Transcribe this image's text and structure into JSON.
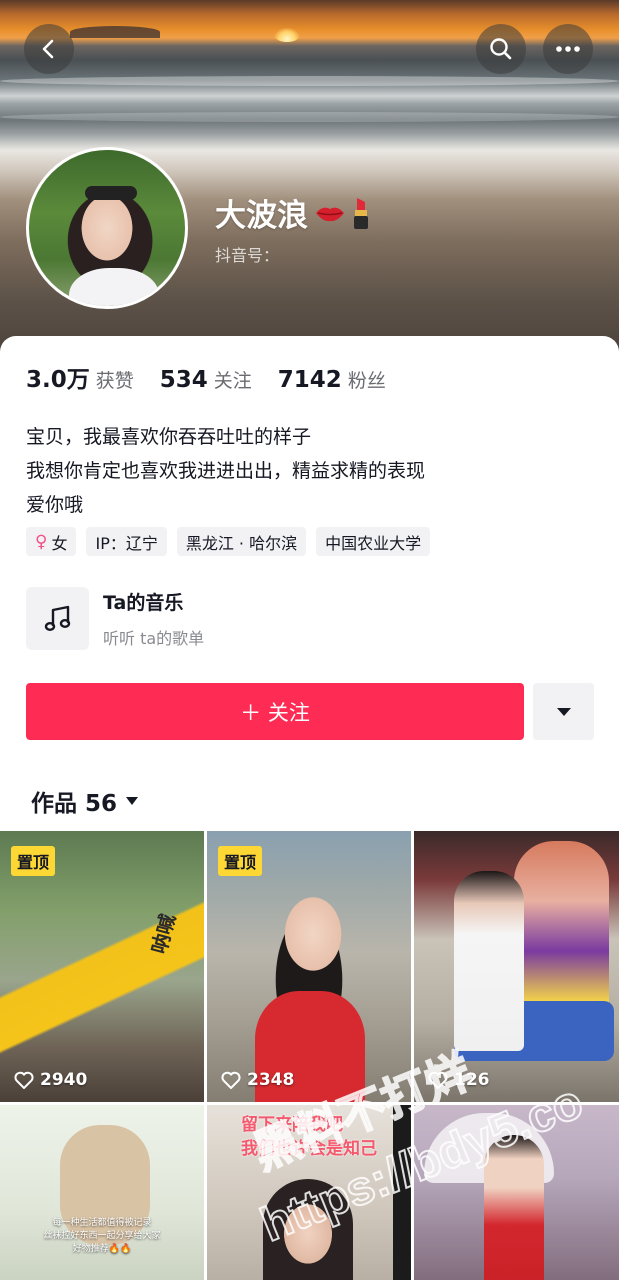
{
  "header": {
    "back_icon": "chevron-left-icon",
    "search_icon": "search-icon",
    "more_icon": "ellipsis-icon"
  },
  "profile": {
    "name": "大波浪",
    "name_emojis": [
      "kiss-lips-emoji",
      "lipstick-emoji"
    ],
    "douyin_id_label": "抖音号："
  },
  "stats": [
    {
      "value": "3.0万",
      "label": "获赞"
    },
    {
      "value": "534",
      "label": "关注"
    },
    {
      "value": "7142",
      "label": "粉丝"
    }
  ],
  "bio": [
    "宝贝，我最喜欢你吞吞吐吐的样子",
    "我想你肯定也喜欢我进进出出，精益求精的表现",
    "爱你哦"
  ],
  "tags": [
    {
      "icon": "female-icon",
      "text": "女"
    },
    {
      "text": "IP：辽宁"
    },
    {
      "text": "黑龙江 · 哈尔滨"
    },
    {
      "text": "中国农业大学"
    }
  ],
  "music": {
    "icon": "music-note-icon",
    "title": "Ta的音乐",
    "subtitle": "听听 ta的歌单"
  },
  "actions": {
    "follow_label": "＋ 关注",
    "more_icon": "triangle-down-icon"
  },
  "works": {
    "label": "作品 56",
    "dropdown_icon": "triangle-down-icon"
  },
  "videos": [
    {
      "pinned": true,
      "pin_label": "置顶",
      "likes": "2940",
      "overlay_text": "呐喊"
    },
    {
      "pinned": true,
      "pin_label": "置顶",
      "likes": "2348"
    },
    {
      "pinned": false,
      "likes": "126"
    },
    {
      "pinned": false,
      "caption": [
        "每一种生活都值得被记录",
        "丝袜控好东西一起分享给大家",
        "好物推荐🔥🔥"
      ]
    },
    {
      "pinned": false,
      "caption": [
        "留下来陪我吧",
        "我们也许会是知己"
      ]
    },
    {
      "pinned": false
    }
  ],
  "watermark": {
    "line1": "黑料不打烊",
    "line2": "https://bdy5.co"
  },
  "colors": {
    "follow_red": "#FE2C55",
    "pin_yellow": "#FDD835",
    "tag_bg": "#F2F2F4"
  }
}
